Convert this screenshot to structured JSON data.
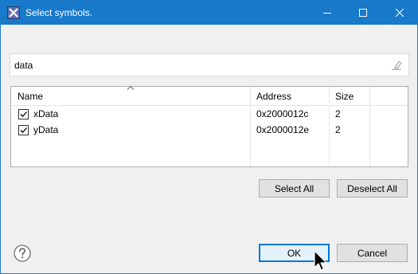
{
  "window": {
    "title": "Select symbols."
  },
  "filter": {
    "value": "data",
    "placeholder": ""
  },
  "table": {
    "columns": [
      "Name",
      "Address",
      "Size"
    ],
    "sorted_column": "Name",
    "rows": [
      {
        "checked": true,
        "name": "xData",
        "address": "0x2000012c",
        "size": "2"
      },
      {
        "checked": true,
        "name": "yData",
        "address": "0x2000012e",
        "size": "2"
      }
    ]
  },
  "buttons": {
    "select_all": "Select All",
    "deselect_all": "Deselect All",
    "ok": "OK",
    "cancel": "Cancel"
  },
  "icons": {
    "app": "x-app-icon",
    "minimize": "minimize-icon",
    "maximize": "maximize-icon",
    "close": "close-icon",
    "clear": "eraser-icon",
    "help": "help-icon",
    "sort": "sort-ascending-icon",
    "cursor": "mouse-pointer-icon"
  },
  "colors": {
    "titlebar": "#1979ca",
    "default_button_border": "#0078d7",
    "default_button_bg": "#e5f1fb"
  }
}
